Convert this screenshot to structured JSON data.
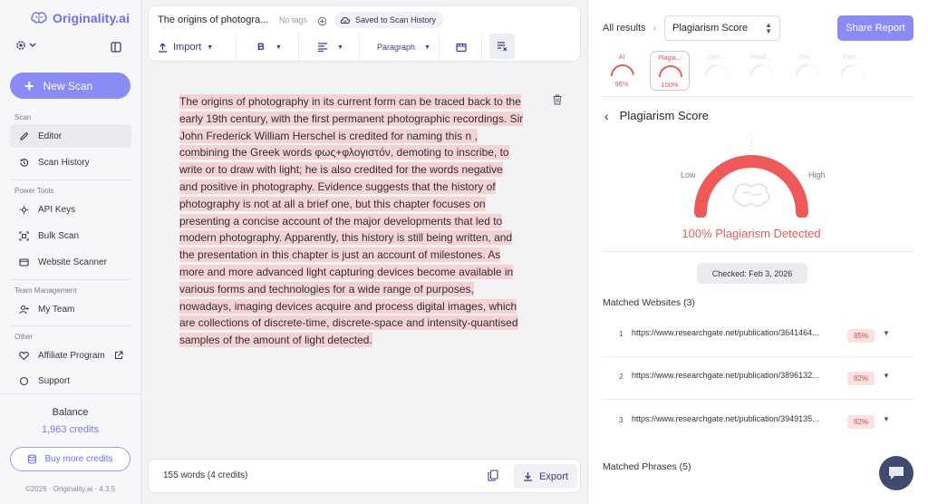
{
  "brand": {
    "name": "Originality.ai"
  },
  "sidebar": {
    "new_scan": "New Scan",
    "sections": {
      "scan": "Scan",
      "power_tools": "Power Tools",
      "team_management": "Team Management",
      "other": "Other"
    },
    "items": {
      "editor": "Editor",
      "scan_history": "Scan History",
      "api_keys": "API Keys",
      "bulk_scan": "Bulk Scan",
      "website_scanner": "Website Scanner",
      "my_team": "My Team",
      "affiliate_program": "Affiliate Program",
      "support": "Support"
    },
    "balance_title": "Balance",
    "balance_value": "1,963 credits",
    "buy_more": "Buy more credits",
    "footer": "©2026 · Originality.ai · 4.3.5"
  },
  "editor": {
    "doc_title": "The origins of photogra...",
    "no_tags": "No tags",
    "saved_status": "Saved to Scan History",
    "toolbar": {
      "import": "Import",
      "bold": "B",
      "paragraph": "Paragraph"
    },
    "content": "The origins of photography in its current form can be traced back to the early 19th century, with the first permanent photographic recordings. Sir John Frederick William Herschel is credited for naming this n , combining the Greek words φως+φλογιστόν, demoting to inscribe, to write or to draw with light; he is also credited for the words negative and positive in photography. Evidence suggests that the history of photography is not at all a brief one, but this chapter focuses on presenting a concise account of the major developments that led to modern photography. Apparently, this history is still being written, and the presentation in this chapter is just an account of milestones. As more and more advanced light capturing devices become available in various forms and technologies for a wide range of purposes, nowadays, imaging devices acquire and process digital images, which are collections of discrete-time, discrete-space and intensity-quantised samples of the amount of light detected.",
    "word_count": "155 words (4 credits)",
    "export": "Export"
  },
  "results": {
    "all_results": "All results",
    "selected_view": "Plagiarism Score",
    "share": "Share Report",
    "score_cards": [
      {
        "label": "AI",
        "value": "96%",
        "fill": 0.96
      },
      {
        "label": "Plagia...",
        "value": "100%",
        "fill": 1.0
      },
      {
        "label": "Opti...",
        "value": "",
        "fill": 0.5
      },
      {
        "label": "Read...",
        "value": "",
        "fill": 0.5
      },
      {
        "label": "Gra...",
        "value": "",
        "fill": 0.5
      },
      {
        "label": "Fact...",
        "value": "",
        "fill": 0.5
      }
    ],
    "score_title": "Plagiarism Score",
    "gauge_low": "Low",
    "gauge_high": "High",
    "gauge_level": 1.0,
    "detected": "100% Plagiarism Detected",
    "checked": "Checked: Feb 3, 2026",
    "matched_websites_title": "Matched Websites (3)",
    "matched_websites": [
      {
        "index": "1",
        "url": "https://www.researchgate.net/publication/3641464...",
        "percent": "85%"
      },
      {
        "index": "2",
        "url": "https://www.researchgate.net/publication/3896132...",
        "percent": "82%"
      },
      {
        "index": "3",
        "url": "https://www.researchgate.net/publication/3949135...",
        "percent": "82%"
      }
    ],
    "matched_phrases_title": "Matched Phrases (5)"
  },
  "colors": {
    "accent": "#8b8bf5",
    "plagiarism": "#e35d5d",
    "highlight": "#f6d3d3"
  }
}
